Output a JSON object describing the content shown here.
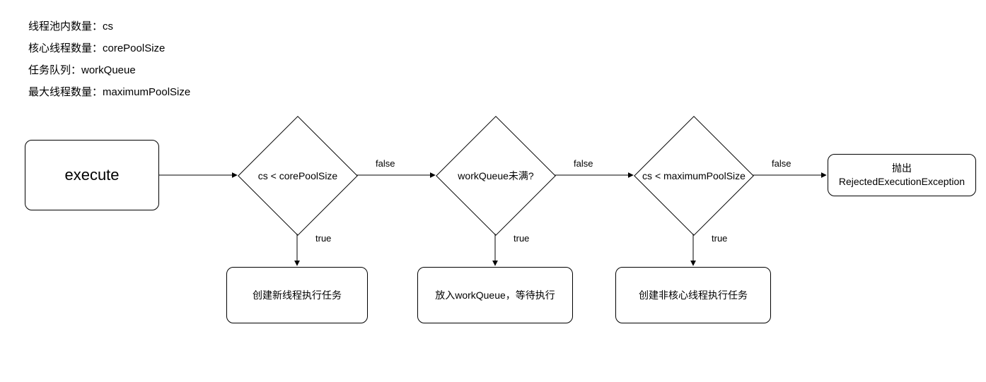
{
  "legend": {
    "line1": "线程池内数量：cs",
    "line2": "核心线程数量：corePoolSize",
    "line3": "任务队列：workQueue",
    "line4": "最大线程数量：maximumPoolSize"
  },
  "nodes": {
    "start": "execute",
    "cond1": "cs < corePoolSize",
    "cond2": "workQueue未满?",
    "cond3": "cs < maximumPoolSize",
    "end": {
      "l1": "抛出",
      "l2": "RejectedExecutionException"
    },
    "act1": "创建新线程执行任务",
    "act2": "放入workQueue，等待执行",
    "act3": "创建非核心线程执行任务"
  },
  "edges": {
    "false": "false",
    "true": "true"
  }
}
